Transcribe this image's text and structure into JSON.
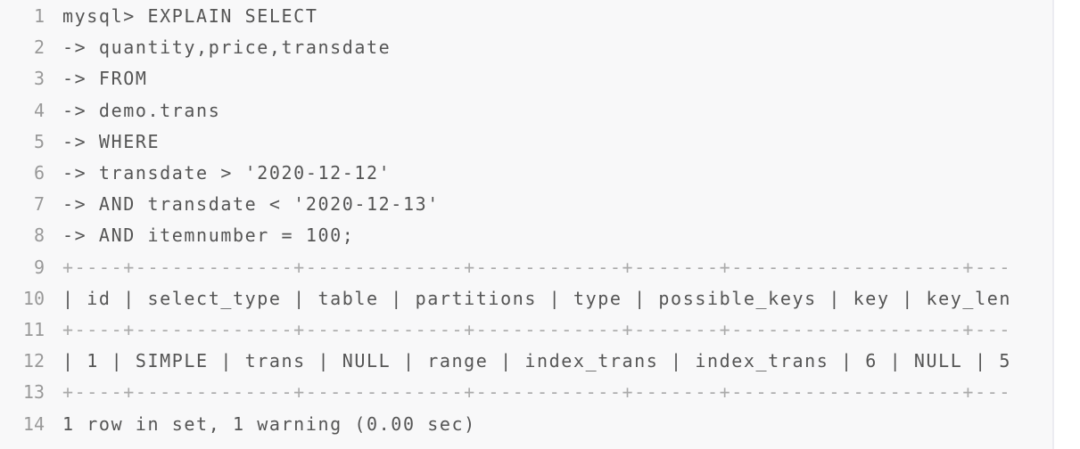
{
  "code_block": {
    "lines": [
      {
        "n": "1",
        "text": "mysql> EXPLAIN SELECT"
      },
      {
        "n": "2",
        "text": "-> quantity,price,transdate"
      },
      {
        "n": "3",
        "text": "-> FROM"
      },
      {
        "n": "4",
        "text": "-> demo.trans"
      },
      {
        "n": "5",
        "text": "-> WHERE"
      },
      {
        "n": "6",
        "text": "-> transdate > '2020-12-12'"
      },
      {
        "n": "7",
        "text": "-> AND transdate < '2020-12-13'"
      },
      {
        "n": "8",
        "text": "-> AND itemnumber = 100;"
      },
      {
        "n": "9",
        "text": "+----+-------------+-------------+------------+-------+-------------------+---"
      },
      {
        "n": "10",
        "text": "| id | select_type | table | partitions | type | possible_keys | key | key_len"
      },
      {
        "n": "11",
        "text": "+----+-------------+-------------+------------+-------+-------------------+---"
      },
      {
        "n": "12",
        "text": "| 1 | SIMPLE | trans | NULL | range | index_trans | index_trans | 6 | NULL | 5"
      },
      {
        "n": "13",
        "text": "+----+-------------+-------------+------------+-------+-------------------+---"
      },
      {
        "n": "14",
        "text": "1 row in set, 1 warning (0.00 sec)"
      }
    ]
  }
}
